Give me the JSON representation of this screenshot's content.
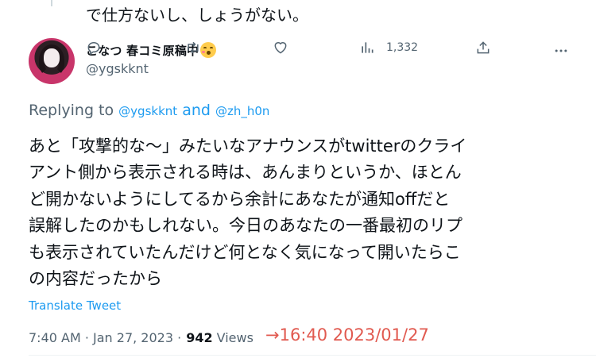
{
  "previous_tweet": {
    "text_fragment": "で仕方ないし、しょうがない。"
  },
  "tweet": {
    "author": {
      "display_name": "こなつ 春コミ原稿中",
      "emoji": "kissing-face-emoji",
      "handle": "@ygskknt"
    },
    "actions": {
      "views_count": "1,332"
    },
    "replying_to": {
      "prefix": "Replying to",
      "mention_1": "@ygskknt",
      "conjunction": "and",
      "mention_2": "@zh_h0n"
    },
    "text_lines": [
      "あと「攻撃的な〜」みたいなアナウンスがtwitterのクライ",
      "アント側から表示される時は、あんまりというか、ほとん",
      "ど開かないようにしてるから余計にあなたが通知offだと",
      "誤解したのかもしれない。今日のあなたの一番最初のリプ",
      "も表示されていたんだけど何となく気になって開いたらこ",
      "の内容だったから"
    ],
    "translate_label": "Translate Tweet",
    "timestamp": "7:40 AM · Jan 27, 2023 ·",
    "views_number": "942",
    "views_label": "Views",
    "annotation": "→16:40  2023/01/27"
  },
  "colors": {
    "link": "#1d9bf0",
    "secondary_text": "#536471",
    "annotation": "#e15a50"
  }
}
